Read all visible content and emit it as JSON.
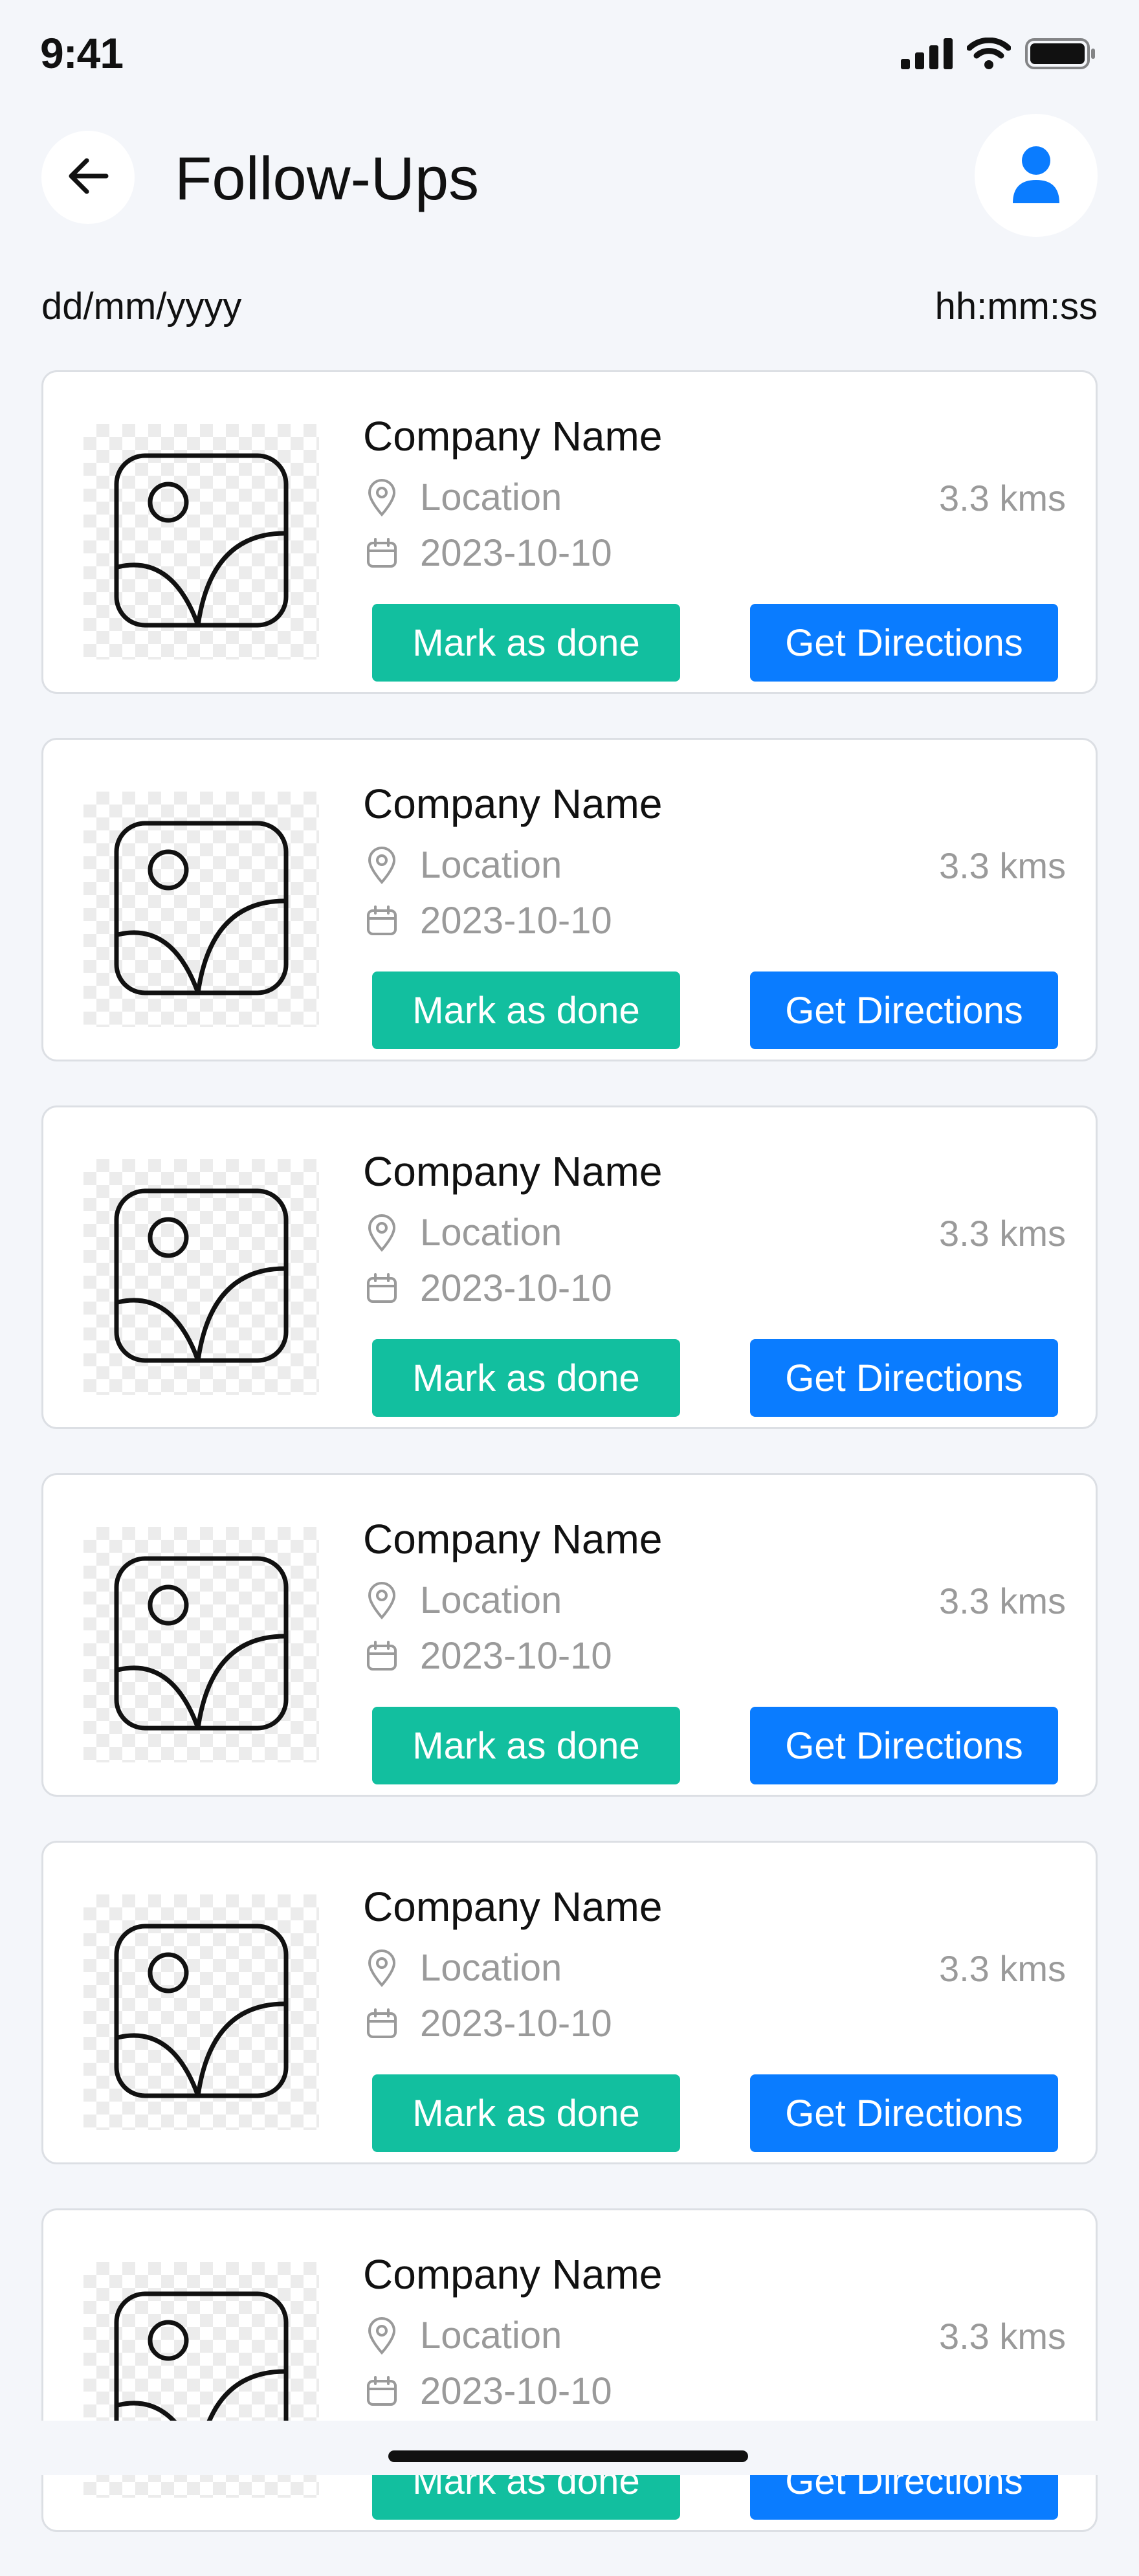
{
  "status_bar": {
    "time": "9:41"
  },
  "header": {
    "title": "Follow-Ups"
  },
  "filters": {
    "date_placeholder": "dd/mm/yyyy",
    "time_placeholder": "hh:mm:ss"
  },
  "followups": [
    {
      "company": "Company Name",
      "location": "Location",
      "date": "2023-10-10",
      "distance": "3.3 kms",
      "done_label": "Mark as done",
      "directions_label": "Get Directions"
    },
    {
      "company": "Company Name",
      "location": "Location",
      "date": "2023-10-10",
      "distance": "3.3 kms",
      "done_label": "Mark as done",
      "directions_label": "Get Directions"
    },
    {
      "company": "Company Name",
      "location": "Location",
      "date": "2023-10-10",
      "distance": "3.3 kms",
      "done_label": "Mark as done",
      "directions_label": "Get Directions"
    },
    {
      "company": "Company Name",
      "location": "Location",
      "date": "2023-10-10",
      "distance": "3.3 kms",
      "done_label": "Mark as done",
      "directions_label": "Get Directions"
    },
    {
      "company": "Company Name",
      "location": "Location",
      "date": "2023-10-10",
      "distance": "3.3 kms",
      "done_label": "Mark as done",
      "directions_label": "Get Directions"
    },
    {
      "company": "Company Name",
      "location": "Location",
      "date": "2023-10-10",
      "distance": "3.3 kms",
      "done_label": "Mark as done",
      "directions_label": "Get Directions"
    }
  ],
  "colors": {
    "accent_blue": "#0a7cff",
    "done_green": "#12bf9f",
    "background": "#f4f6fa"
  },
  "icons": {
    "back": "arrow-left-icon",
    "profile": "user-icon",
    "location": "map-pin-icon",
    "date": "calendar-icon",
    "thumbnail": "image-placeholder-icon",
    "signal": "cellular-signal-icon",
    "wifi": "wifi-icon",
    "battery": "battery-icon"
  }
}
